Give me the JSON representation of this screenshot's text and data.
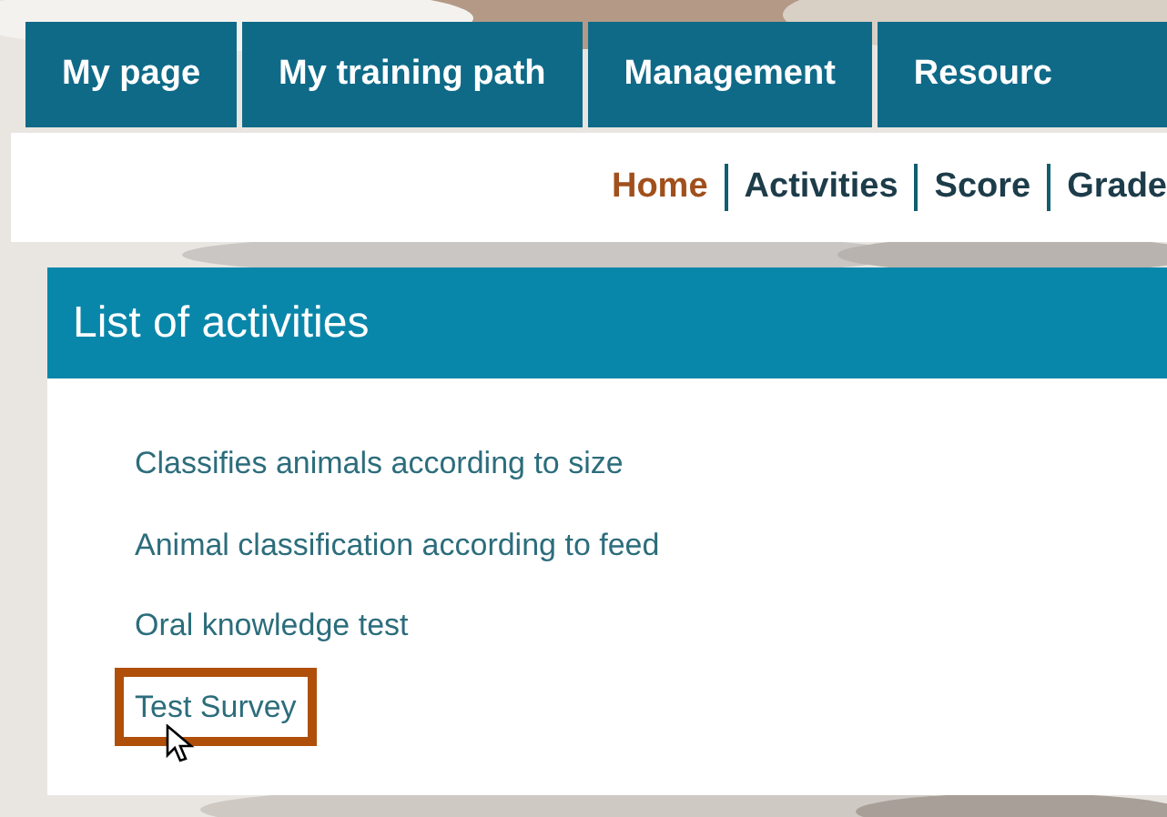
{
  "main_nav": [
    {
      "label": "My page",
      "selected": false
    },
    {
      "label": "My training path",
      "selected": false
    },
    {
      "label": "Management",
      "selected": false
    },
    {
      "label": "Resourc",
      "selected": false
    }
  ],
  "sub_nav": [
    {
      "label": "Home",
      "selected": true
    },
    {
      "label": "Activities",
      "selected": false
    },
    {
      "label": "Score",
      "selected": false
    },
    {
      "label": "Grade",
      "selected": false
    }
  ],
  "panel": {
    "title": "List of activities",
    "activities": [
      {
        "label": "Classifies animals according to size",
        "highlighted": false
      },
      {
        "label": "Animal classification according to feed",
        "highlighted": false
      },
      {
        "label": "Oral knowledge test",
        "highlighted": false
      },
      {
        "label": "Test Survey",
        "highlighted": true
      }
    ]
  }
}
